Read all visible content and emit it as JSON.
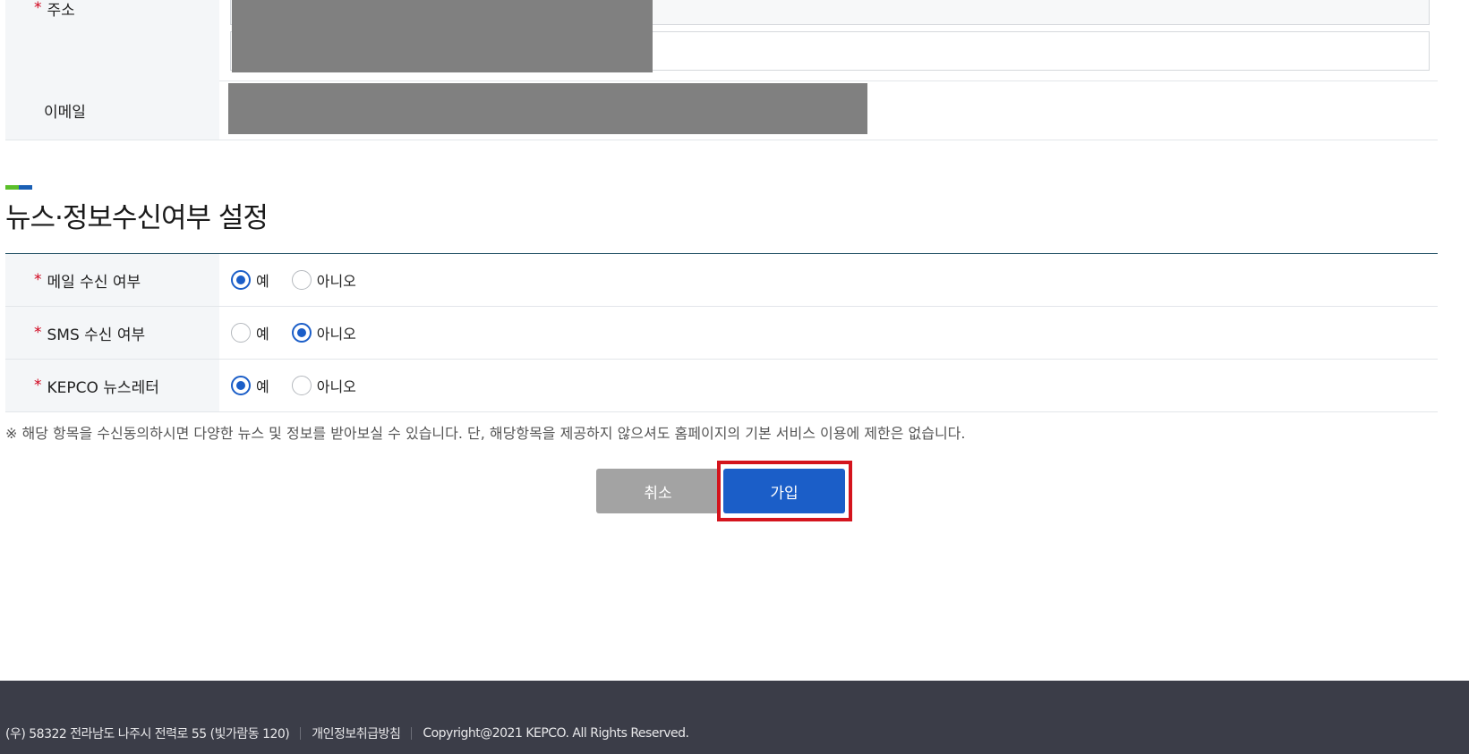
{
  "address_row": {
    "label": "주소",
    "required_mark": "*"
  },
  "email_row": {
    "label": "이메일"
  },
  "section": {
    "title": "뉴스·정보수신여부 설정"
  },
  "prefs": [
    {
      "label": "메일 수신 여부",
      "options": [
        "예",
        "아니오"
      ],
      "selected": "예"
    },
    {
      "label": "SMS 수신 여부",
      "options": [
        "예",
        "아니오"
      ],
      "selected": "아니오"
    },
    {
      "label": "KEPCO 뉴스레터",
      "options": [
        "예",
        "아니오"
      ],
      "selected": "예"
    }
  ],
  "notice": "※ 해당 항목을 수신동의하시면 다양한 뉴스 및 정보를 받아보실 수 있습니다. 단, 해당항목을 제공하지 않으셔도 홈페이지의 기본 서비스 이용에 제한은 없습니다.",
  "buttons": {
    "cancel": "취소",
    "join": "가입"
  },
  "footer": {
    "address": "(우) 58322 전라남도 나주시 전력로 55 (빛가람동 120)",
    "privacy_link": "개인정보취급방침",
    "copyright": "Copyright@2021 KEPCO. All Rights Reserved."
  },
  "colors": {
    "accent": "#1b5ec8",
    "required": "#d0021b",
    "footer_bg": "#3b3d48",
    "highlight": "#d4141d"
  }
}
